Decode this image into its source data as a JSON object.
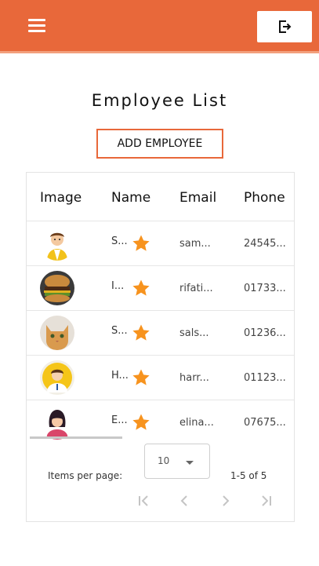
{
  "toolbar": {
    "menu_icon": "menu-icon",
    "logout_icon": "logout-icon",
    "color": "#e8683a"
  },
  "page": {
    "title": "Employee List",
    "add_button_label": "ADD EMPLOYEE"
  },
  "table": {
    "columns": [
      "Image",
      "Name",
      "Email",
      "Phone"
    ],
    "rows": [
      {
        "avatar": "man-cartoon-avatar",
        "name": "S...",
        "email": "sam...",
        "phone": "24545..."
      },
      {
        "avatar": "burger-photo-avatar",
        "name": "I...",
        "email": "rifati...",
        "phone": "01733..."
      },
      {
        "avatar": "cat-photo-avatar",
        "name": "S...",
        "email": "sals...",
        "phone": "01236..."
      },
      {
        "avatar": "man-illustration-avatar",
        "name": "H...",
        "email": "harr...",
        "phone": "01123..."
      },
      {
        "avatar": "woman-illustration-avatar",
        "name": "E...",
        "email": "elina...",
        "phone": "07675..."
      }
    ],
    "star_color": "#f7931e"
  },
  "paginator": {
    "items_per_page_label": "Items per page:",
    "items_per_page_value": "10",
    "range_label": "1-5 of 5"
  }
}
